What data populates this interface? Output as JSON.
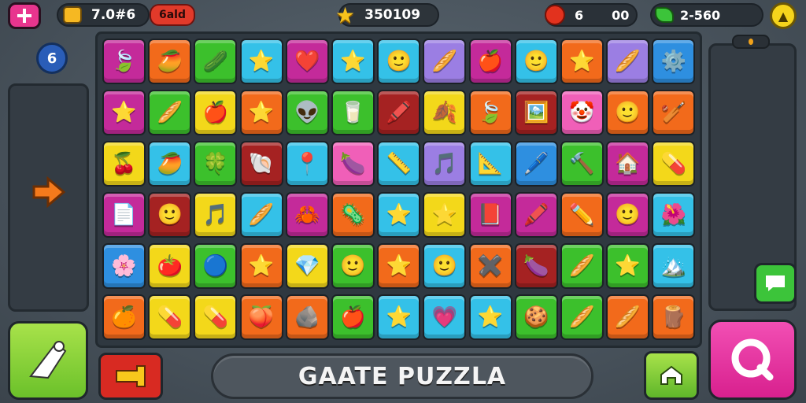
{
  "hud": {
    "timer": "7.0#6",
    "gold_label": "6ald",
    "score": "350109",
    "gem_left": "6",
    "gem_right": "00",
    "energy": "2-560",
    "level_badge": "6"
  },
  "icons": {
    "plus": "plus-icon",
    "face": "face-icon",
    "star": "star-icon",
    "gem": "red-gem-icon",
    "leaf": "green-leaf-icon",
    "arrow_up": "arrow-up-icon",
    "arrow_right": "arrow-right-icon",
    "ghost": "ghost-icon",
    "fist": "fist-icon",
    "home": "home-icon",
    "search": "search-icon",
    "chat": "chat-icon"
  },
  "title": "GAATE PUZZLA",
  "colors": {
    "magenta": "#c42a9a",
    "orange": "#f26a1b",
    "green": "#3cc02c",
    "cyan": "#34c1e8",
    "red": "#d92b2b",
    "yellow": "#f3d81a",
    "purple": "#9b7ee3",
    "blue": "#2e8fe0",
    "pink": "#f05fb8",
    "darkred": "#a52222"
  },
  "grid": [
    [
      [
        "magenta",
        "🍃"
      ],
      [
        "orange",
        "🥭"
      ],
      [
        "green",
        "🥒"
      ],
      [
        "cyan",
        "⭐"
      ],
      [
        "magenta",
        "❤️"
      ],
      [
        "cyan",
        "⭐"
      ],
      [
        "cyan",
        "🙂"
      ],
      [
        "purple",
        "🥖"
      ],
      [
        "magenta",
        "🍎"
      ],
      [
        "cyan",
        "🙂"
      ],
      [
        "orange",
        "⭐"
      ],
      [
        "purple",
        "🥖"
      ],
      [
        "blue",
        "⚙️"
      ]
    ],
    [
      [
        "magenta",
        "⭐"
      ],
      [
        "green",
        "🥖"
      ],
      [
        "yellow",
        "🍎"
      ],
      [
        "orange",
        "⭐"
      ],
      [
        "green",
        "👽"
      ],
      [
        "green",
        "🥛"
      ],
      [
        "darkred",
        "🖍️"
      ],
      [
        "yellow",
        "🍂"
      ],
      [
        "orange",
        "🍃"
      ],
      [
        "darkred",
        "🖼️"
      ],
      [
        "pink",
        "🤡"
      ],
      [
        "orange",
        "🙂"
      ],
      [
        "orange",
        "🏏"
      ]
    ],
    [
      [
        "yellow",
        "🍒"
      ],
      [
        "cyan",
        "🥭"
      ],
      [
        "green",
        "🍀"
      ],
      [
        "darkred",
        "🐚"
      ],
      [
        "cyan",
        "📍"
      ],
      [
        "pink",
        "🍆"
      ],
      [
        "cyan",
        "📏"
      ],
      [
        "purple",
        "🎵"
      ],
      [
        "cyan",
        "📐"
      ],
      [
        "blue",
        "🖊️"
      ],
      [
        "green",
        "🔨"
      ],
      [
        "magenta",
        "🏠"
      ],
      [
        "yellow",
        "💊"
      ]
    ],
    [
      [
        "magenta",
        "📄"
      ],
      [
        "darkred",
        "🙂"
      ],
      [
        "yellow",
        "🎵"
      ],
      [
        "cyan",
        "🥖"
      ],
      [
        "magenta",
        "🦀"
      ],
      [
        "orange",
        "🦠"
      ],
      [
        "cyan",
        "⭐"
      ],
      [
        "yellow",
        "⭐"
      ],
      [
        "magenta",
        "📕"
      ],
      [
        "magenta",
        "🖍️"
      ],
      [
        "orange",
        "✏️"
      ],
      [
        "magenta",
        "🙂"
      ],
      [
        "cyan",
        "🌺"
      ]
    ],
    [
      [
        "blue",
        "🌸"
      ],
      [
        "yellow",
        "🍅"
      ],
      [
        "green",
        "🔵"
      ],
      [
        "orange",
        "⭐"
      ],
      [
        "yellow",
        "💎"
      ],
      [
        "green",
        "🙂"
      ],
      [
        "orange",
        "⭐"
      ],
      [
        "cyan",
        "🙂"
      ],
      [
        "orange",
        "✖️"
      ],
      [
        "darkred",
        "🍆"
      ],
      [
        "green",
        "🥖"
      ],
      [
        "green",
        "⭐"
      ],
      [
        "cyan",
        "🏔️"
      ]
    ],
    [
      [
        "orange",
        "🍊"
      ],
      [
        "yellow",
        "💊"
      ],
      [
        "yellow",
        "💊"
      ],
      [
        "orange",
        "🍑"
      ],
      [
        "orange",
        "🪨"
      ],
      [
        "green",
        "🍎"
      ],
      [
        "cyan",
        "⭐"
      ],
      [
        "cyan",
        "💗"
      ],
      [
        "cyan",
        "⭐"
      ],
      [
        "green",
        "🍪"
      ],
      [
        "green",
        "🥖"
      ],
      [
        "orange",
        "🥖"
      ],
      [
        "orange",
        "🪵"
      ]
    ]
  ]
}
